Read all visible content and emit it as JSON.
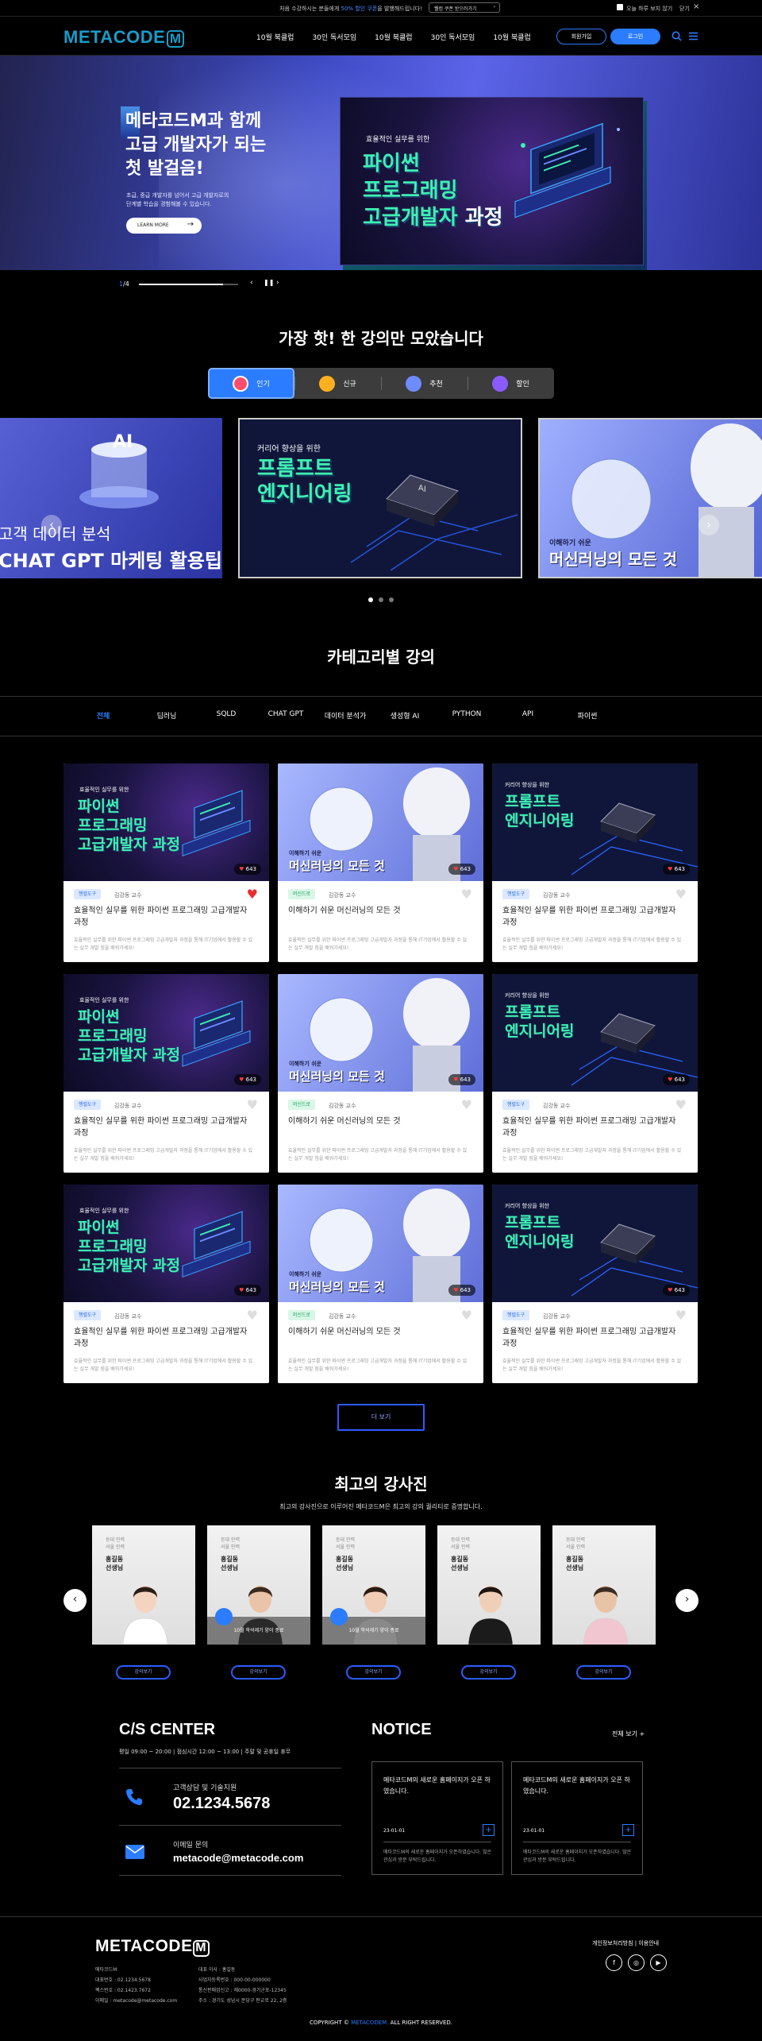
{
  "topbar": {
    "message_pre": "처음 수강하시는 분들에게 ",
    "message_hl": "50% 할인 쿠폰",
    "message_post": "을 발행해드립니다!",
    "cta": "웰컴 쿠폰 받으러가기",
    "today": "오늘 하루 보지 않기",
    "close": "닫기"
  },
  "header": {
    "logo": "METACODE",
    "logo_mark": "M",
    "nav": [
      "10월 북클럽",
      "30인 독서모임",
      "10월 북클럽",
      "30인 독서모임",
      "10월 북클럽"
    ],
    "join": "회원가입",
    "login": "로그인"
  },
  "hero": {
    "headline": [
      "메타코드M과 함께",
      "고급 개발자가 되는",
      "첫 발걸음!"
    ],
    "desc": [
      "초급, 중급 개발자를 넘어서 고급 개발자로의",
      "단계별 학습을 경험해볼 수 있습니다."
    ],
    "learn_more": "LEARN MORE",
    "card_small": "효율적인 실무를 위한",
    "card_t1": "파이썬",
    "card_t2": "프로그래밍",
    "card_t3a": "고급개발자",
    "card_t3b": " 과정",
    "pager_cur": "1",
    "pager_total": "/4",
    "progress": 0.85
  },
  "hot": {
    "title": "가장 핫! 한 강의만 모았습니다",
    "tabs": [
      "인기",
      "신규",
      "추천",
      "할인"
    ],
    "slides": [
      {
        "l1": "고객 데이터 분석",
        "l2": "CHAT GPT 마케팅 활용팁",
        "badge": "AI"
      },
      {
        "small": "커리어 향상을 위한",
        "t1": "프롬프트",
        "t2": "엔지니어링",
        "chip": "AI"
      },
      {
        "small": "이해하기 쉬운",
        "t1": "머신러닝의 모든 것"
      }
    ]
  },
  "category": {
    "title": "카테고리별 강의",
    "tabs": [
      "전체",
      "딥러닝",
      "SQLD",
      "CHAT GPT",
      "데이터 분석가",
      "생성형 AI",
      "PYTHON",
      "API",
      "파이썬"
    ],
    "cards": [
      {
        "type": "python",
        "badge": "행렬도구",
        "badge_color": "blue",
        "teacher": "김강동 교수",
        "title": "효율적인 실무를 위한 파이썬 프로그래밍 고급개발자 과정",
        "liked": true
      },
      {
        "type": "ml",
        "badge": "머신드로",
        "badge_color": "green",
        "teacher": "김강동 교수",
        "title": "이해하기 쉬운 머신러닝의 모든 것",
        "liked": false
      },
      {
        "type": "prompt",
        "badge": "행렬도구",
        "badge_color": "blue",
        "teacher": "김강동 교수",
        "title": "효율적인 실무를 위한 파이썬 프로그래밍 고급개발자 과정",
        "liked": false
      },
      {
        "type": "python",
        "badge": "행렬도구",
        "badge_color": "blue",
        "teacher": "김강동 교수",
        "title": "효율적인 실무를 위한 파이썬 프로그래밍 고급개발자 과정",
        "liked": false
      },
      {
        "type": "ml",
        "badge": "머신드로",
        "badge_color": "green",
        "teacher": "김강동 교수",
        "title": "이해하기 쉬운 머신러닝의 모든 것",
        "liked": false
      },
      {
        "type": "prompt",
        "badge": "행렬도구",
        "badge_color": "blue",
        "teacher": "김강동 교수",
        "title": "효율적인 실무를 위한 파이썬 프로그래밍 고급개발자 과정",
        "liked": false
      },
      {
        "type": "python",
        "badge": "행렬도구",
        "badge_color": "blue",
        "teacher": "김강동 교수",
        "title": "효율적인 실무를 위한 파이썬 프로그래밍 고급개발자 과정",
        "liked": false
      },
      {
        "type": "ml",
        "badge": "머신드로",
        "badge_color": "green",
        "teacher": "김강동 교수",
        "title": "이해하기 쉬운 머신러닝의 모든 것",
        "liked": false
      },
      {
        "type": "prompt",
        "badge": "행렬도구",
        "badge_color": "blue",
        "teacher": "김강동 교수",
        "title": "효율적인 실무를 위한 파이썬 프로그래밍 고급개발자 과정",
        "liked": false
      }
    ],
    "likes": "643",
    "card_desc": "효율적인 실무를 위한 파이썬 프로그래밍 고급개발자 과정을 통해 IT기업에서 활용할 수 있는 실무 개발 힘을 배워가세요!",
    "thumb_python": {
      "small": "효율적인 실무를 위한",
      "t1": "파이썬",
      "t2": "프로그래밍",
      "t3": "고급개발자 과정"
    },
    "thumb_ml": {
      "small": "이해하기 쉬운",
      "t1": "머신러닝의 모든 것"
    },
    "thumb_prompt": {
      "small": "커리어 향상을 위한",
      "t1": "프롬프트",
      "t2": "엔지니어링"
    },
    "more": "더 보기"
  },
  "teachers": {
    "title": "최고의 강사진",
    "subtitle": "최고의 강사진으로 이루어진 메타코드M은 최고의 강의 퀄리티로 증명합니다.",
    "items": [
      {
        "small": [
          "등대 인력",
          "서울 인력"
        ],
        "name": [
          "홍길동",
          "선생님"
        ],
        "band": ""
      },
      {
        "small": [
          "등대 인력",
          "서울 인력"
        ],
        "name": [
          "홍길동",
          "선생님"
        ],
        "band": "10월 학석제기 양이 종료"
      },
      {
        "small": [
          "등대 인력",
          "서울 인력"
        ],
        "name": [
          "홍길동",
          "선생님"
        ],
        "band": "10월 학석제기 양이 종료"
      },
      {
        "small": [
          "등대 인력",
          "서울 인력"
        ],
        "name": [
          "홍길동",
          "선생님"
        ],
        "band": ""
      },
      {
        "small": [
          "등대 인력",
          "서울 인력"
        ],
        "name": [
          "홍길동",
          "선생님"
        ],
        "band": ""
      }
    ],
    "btn": "강의보기"
  },
  "cs": {
    "title": "C/S CENTER",
    "hours": "평일 09:00 ~ 20:00  |  점심시간 12:00 ~ 13:00  |  주말 및 공휴일 휴무",
    "tel_label": "고객상담 및 기술지원",
    "tel": "02.1234.5678",
    "mail_label": "이메일 문의",
    "mail": "metacode@metacode.com"
  },
  "notice": {
    "title": "NOTICE",
    "all": "전체 보기 +",
    "items": [
      {
        "head": "메타코드M의 새로운 홈페이지가 오픈 하였습니다.",
        "date": "23-01-01",
        "body": "메타코드M의 새로운 홈페이지가 오픈하였습니다. 많은 관심과 방문 부탁드립니다."
      },
      {
        "head": "메타코드M의 새로운 홈페이지가 오픈 하였습니다.",
        "date": "23-01-01",
        "body": "메타코드M의 새로운 홈페이지가 오픈하였습니다. 많은 관심과 방문 부탁드립니다."
      }
    ]
  },
  "footer": {
    "logo": "METACODE",
    "logo_mark": "M",
    "col1": [
      "메타코드M",
      "대표번호 : 02.1234.5678",
      "팩스번호 : 02.1423.7672",
      "이메일 : metacode@metacode.com"
    ],
    "col2": [
      "대표 이사 : 홍길동",
      "사업자등록번호 : 000-00-000000",
      "통신판매업신고 : 제0000-경기군포-12345",
      "주소 : 경기도 성남시 분당구 판교로 22, 2층"
    ],
    "privacy": "개인정보처리방침",
    "terms": "이용안내",
    "copyright_pre": "COPYRIGHT © ",
    "copyright_hl": "METACODEM.",
    "copyright_post": " ALL RIGHT RESERVED."
  },
  "colors": {
    "accent": "#2b7cff",
    "brand_logo": "#1a9bc9",
    "neon_green": "#3ff0b3"
  }
}
